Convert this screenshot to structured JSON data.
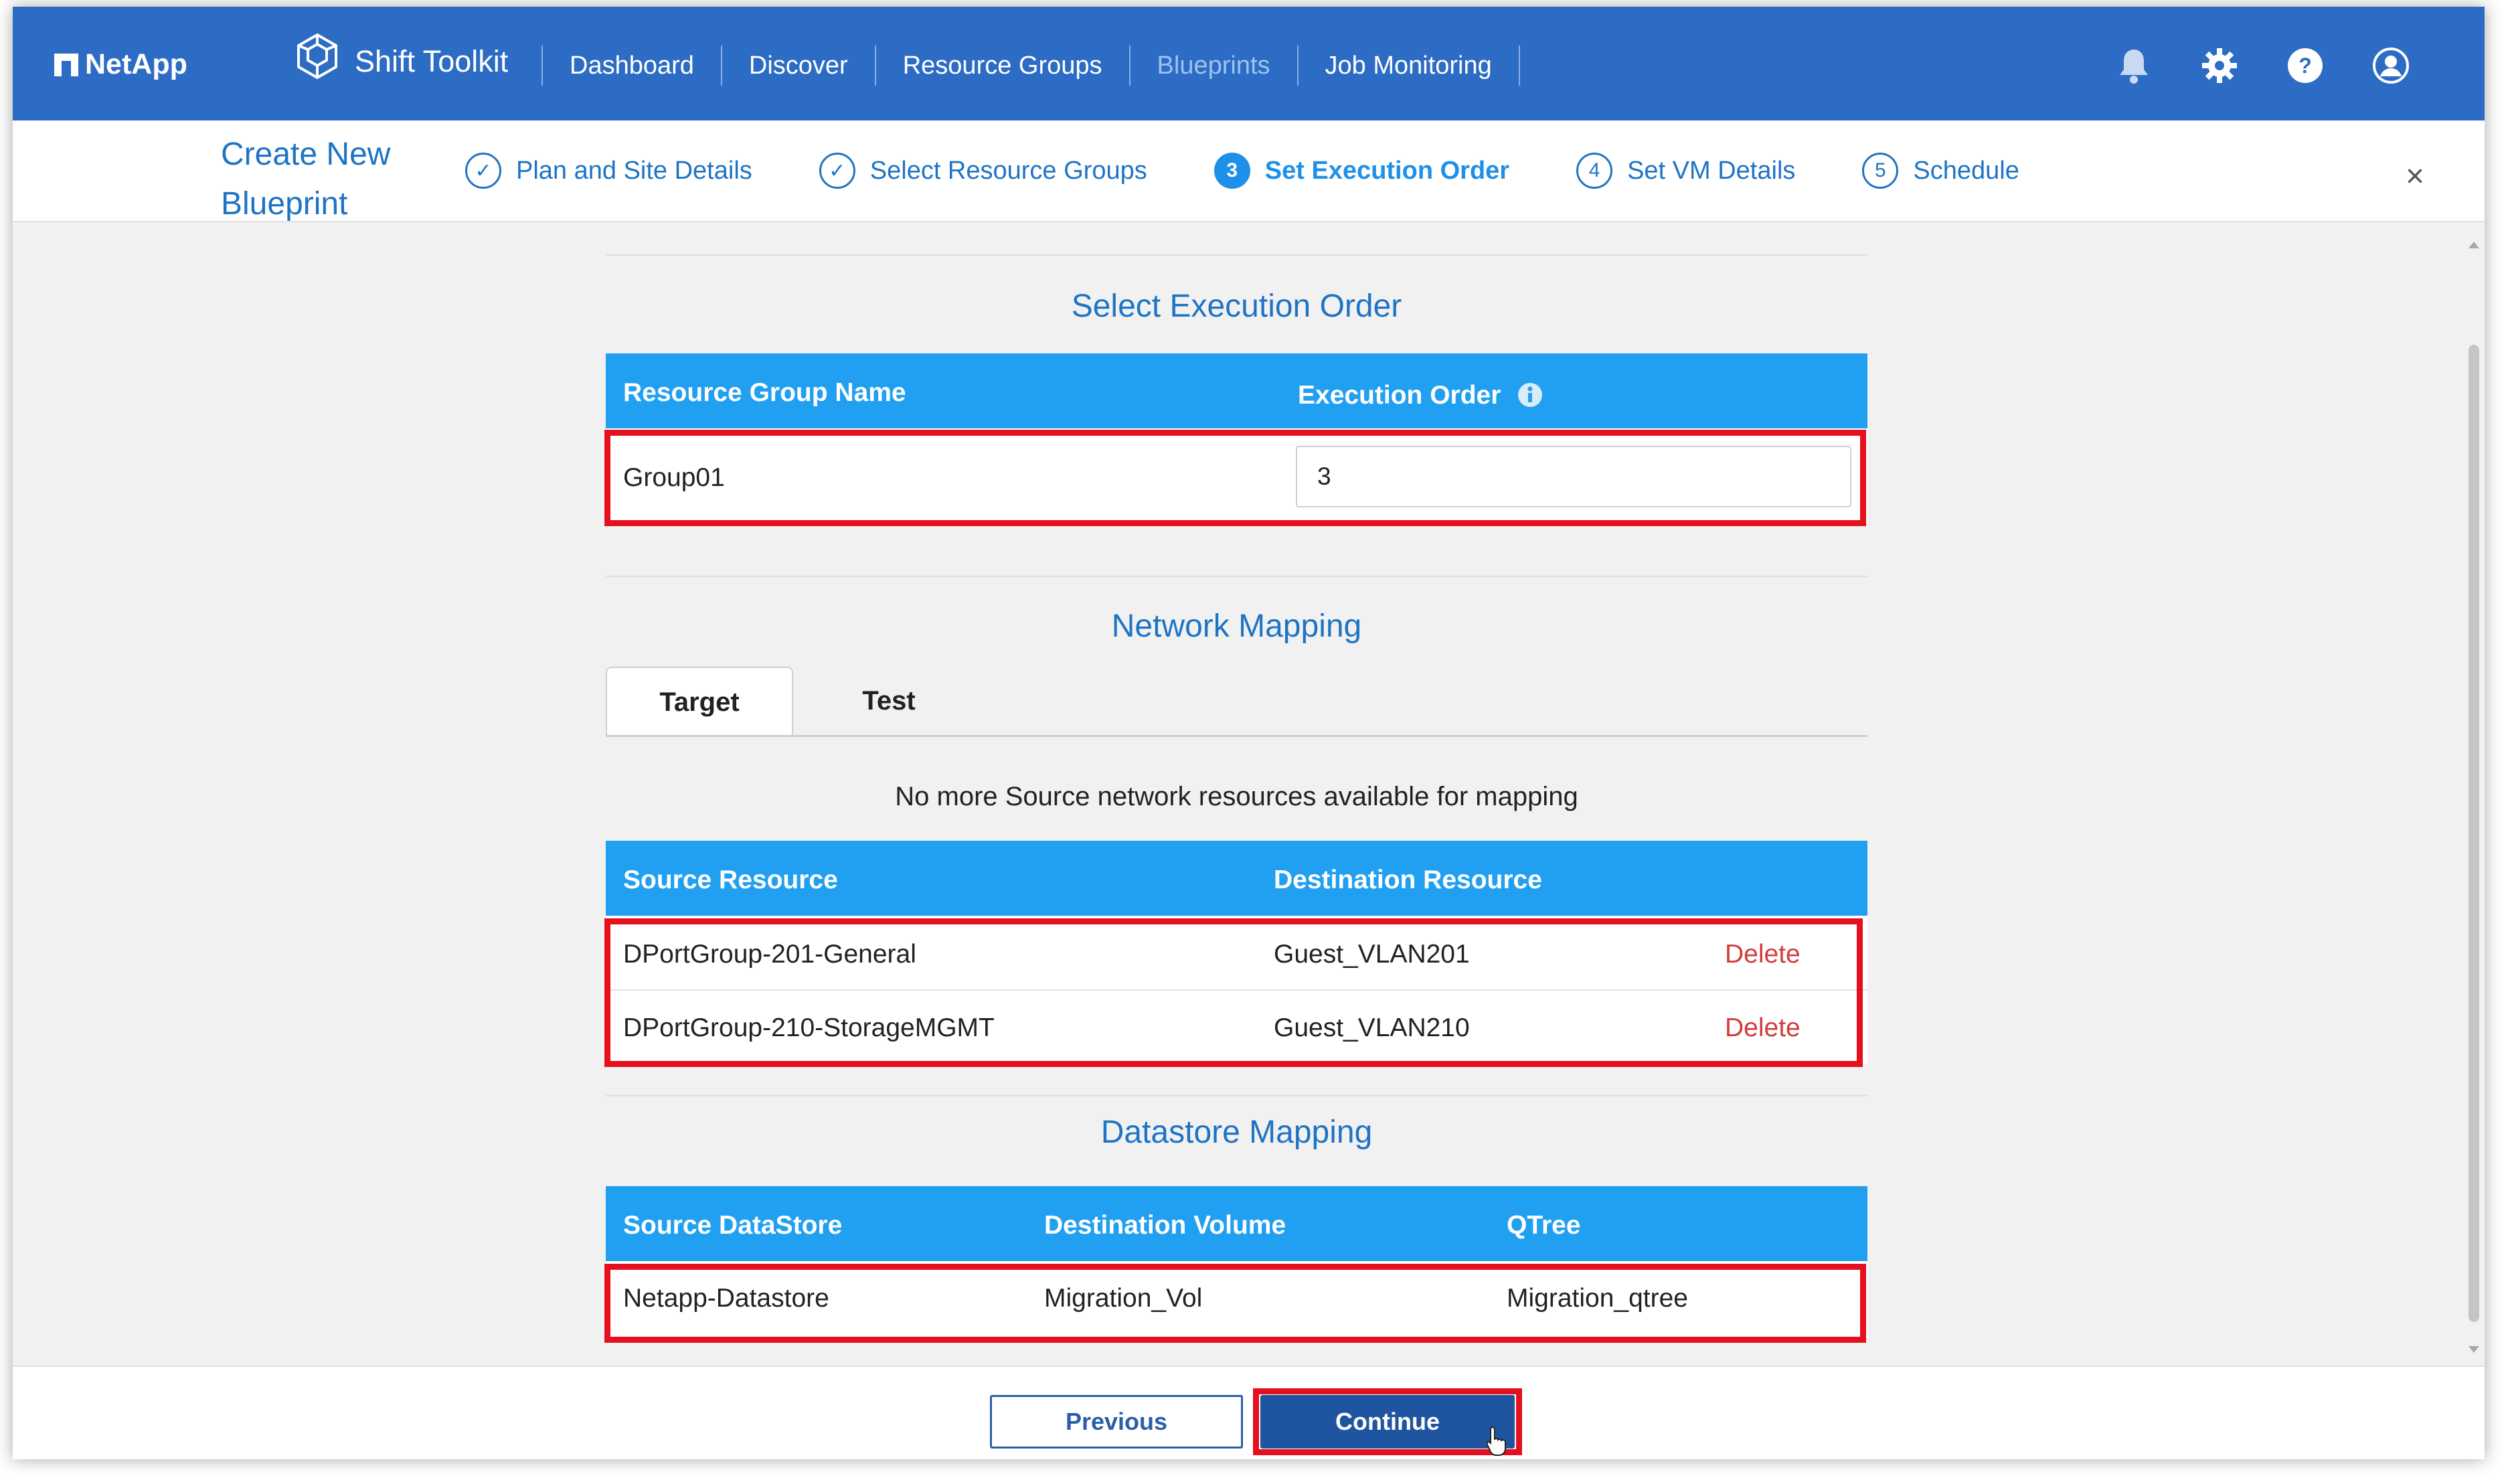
{
  "brand": {
    "name": "NetApp"
  },
  "product": {
    "name": "Shift Toolkit"
  },
  "nav": {
    "items": [
      "Dashboard",
      "Discover",
      "Resource Groups",
      "Blueprints",
      "Job Monitoring"
    ],
    "active": "Blueprints"
  },
  "wizard": {
    "title_line1": "Create New",
    "title_line2": "Blueprint",
    "steps": [
      {
        "marker": "✓",
        "label": "Plan and Site Details",
        "state": "done"
      },
      {
        "marker": "✓",
        "label": "Select Resource Groups",
        "state": "done"
      },
      {
        "marker": "3",
        "label": "Set Execution Order",
        "state": "active"
      },
      {
        "marker": "4",
        "label": "Set VM Details",
        "state": "pending"
      },
      {
        "marker": "5",
        "label": "Schedule",
        "state": "pending"
      }
    ],
    "close": "×"
  },
  "execution": {
    "title": "Select Execution Order",
    "headers": {
      "group": "Resource Group Name",
      "order": "Execution Order"
    },
    "row": {
      "group": "Group01",
      "order": "3"
    }
  },
  "network": {
    "title": "Network Mapping",
    "tabs": [
      "Target",
      "Test"
    ],
    "note": "No more Source network resources available for mapping",
    "headers": {
      "source": "Source Resource",
      "destination": "Destination Resource"
    },
    "rows": [
      {
        "source": "DPortGroup-201-General",
        "destination": "Guest_VLAN201",
        "action": "Delete"
      },
      {
        "source": "DPortGroup-210-StorageMGMT",
        "destination": "Guest_VLAN210",
        "action": "Delete"
      }
    ]
  },
  "datastore": {
    "title": "Datastore Mapping",
    "headers": {
      "source": "Source DataStore",
      "destination": "Destination Volume",
      "qtree": "QTree"
    },
    "row": {
      "source": "Netapp-Datastore",
      "destination": "Migration_Vol",
      "qtree": "Migration_qtree"
    }
  },
  "footer": {
    "previous": "Previous",
    "continue": "Continue"
  },
  "colors": {
    "header": "#2d6cc4",
    "table_header": "#21a0f2",
    "highlight": "#e5101d",
    "delete": "#d23c3c"
  }
}
